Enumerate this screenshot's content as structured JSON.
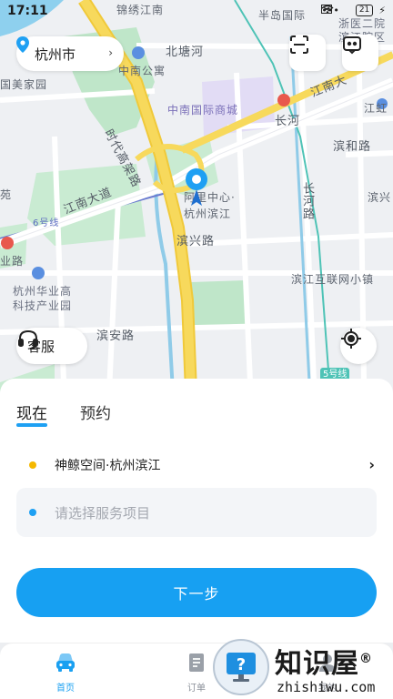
{
  "status_bar": {
    "time": "17:11",
    "signal_text": "•••",
    "battery": "21"
  },
  "map": {
    "city_selector": {
      "city": "杭州市",
      "chevron": "›"
    },
    "labels": {
      "jinxiu": "锦绣江南",
      "bandao": "半岛国际",
      "zheyi": "浙医二院",
      "zheyi2": "滨江院区",
      "beitang": "北塘河",
      "zhongnan_apt": "中南公寓",
      "meijiayuan": "国美家园",
      "jiangnan_ave": "江南大道",
      "jiangnan_ave2": "江南大",
      "shidai": "时代高架路",
      "zhongnan_mall": "中南国际商城",
      "changhe": "长河",
      "jianghong": "江虹",
      "binhe": "滨和路",
      "changhe_road": "长河路",
      "binxing2": "滨兴",
      "alibaba1": "阿里中心·",
      "alibaba2": "杭州滨江",
      "binxing": "滨兴路",
      "line6": "6号线",
      "yelu": "业路",
      "binjiang_town": "滨江互联网小镇",
      "huaye1": "杭州华业高",
      "huaye2": "科技产业园",
      "binan": "滨安路",
      "line5": "5号线",
      "yuan": "苑"
    },
    "service_button": "客服"
  },
  "sheet": {
    "tabs": [
      {
        "label": "现在",
        "active": true
      },
      {
        "label": "预约",
        "active": false
      }
    ],
    "origin": "神鲸空间·杭州滨江",
    "origin_arrow": "›",
    "service_placeholder": "请选择服务项目",
    "next_label": "下一步"
  },
  "nav": {
    "items": [
      {
        "label": "首页",
        "icon": "car-icon",
        "active": true
      },
      {
        "label": "订单",
        "icon": "order-icon",
        "active": false
      },
      {
        "label": "我的",
        "icon": "profile-icon",
        "active": false
      }
    ]
  },
  "watermark": {
    "title": "知识屋",
    "sub": "zhishiwu.com",
    "reg": "®"
  },
  "colors": {
    "accent": "#17a0f2",
    "origin_dot": "#f5b800",
    "service_dot": "#1ea0f3",
    "highway": "#f7d555",
    "water": "#8ed0ee",
    "park": "#b6e4c3"
  }
}
